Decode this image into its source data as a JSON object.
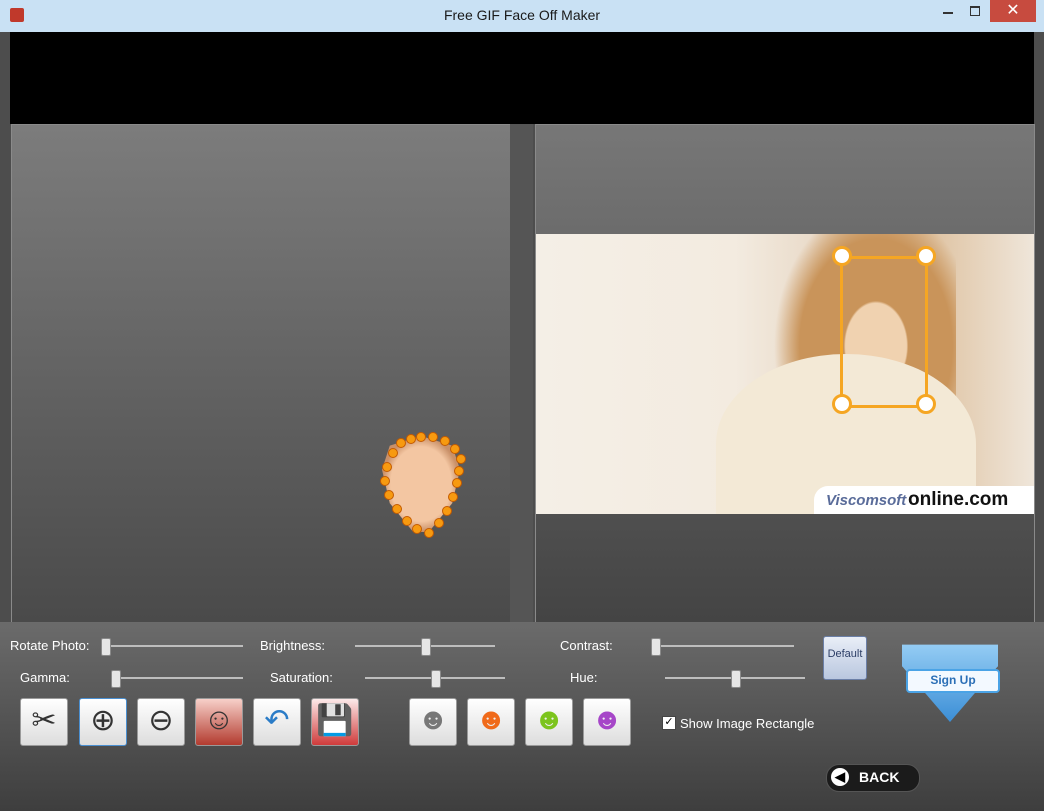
{
  "window": {
    "title": "Free GIF Face Off Maker",
    "close_glyph": "✕"
  },
  "watermark": {
    "part1": "Viscomsoft",
    "part2": "online.com"
  },
  "controls": {
    "rotate_label": "Rotate Photo:",
    "brightness_label": "Brightness:",
    "contrast_label": "Contrast:",
    "gamma_label": "Gamma:",
    "saturation_label": "Saturation:",
    "hue_label": "Hue:",
    "default_button": "Default",
    "show_rect_label": "Show Image Rectangle",
    "show_rect_checked": true,
    "checkbox_glyph": "✓"
  },
  "tools": [
    {
      "icon": "scissors-icon",
      "glyph": "✂"
    },
    {
      "icon": "zoom-in-icon",
      "glyph": "⊕"
    },
    {
      "icon": "zoom-out-icon",
      "glyph": "⊖"
    },
    {
      "icon": "faces-icon",
      "glyph": "☺"
    },
    {
      "icon": "undo-icon",
      "glyph": "↶"
    },
    {
      "icon": "save-icon",
      "glyph": "💾"
    },
    {
      "icon": "face-gray-icon",
      "glyph": "☻"
    },
    {
      "icon": "face-orange-icon",
      "glyph": "☻"
    },
    {
      "icon": "face-green-icon",
      "glyph": "☻"
    },
    {
      "icon": "face-purple-icon",
      "glyph": "☻"
    }
  ],
  "signup": {
    "label": "Sign Up"
  },
  "back": {
    "label": "BACK",
    "glyph": "◀"
  },
  "colors": {
    "accent": "#f5a623",
    "brand_blue": "#3b8ed6",
    "dot": "#f79a10"
  }
}
